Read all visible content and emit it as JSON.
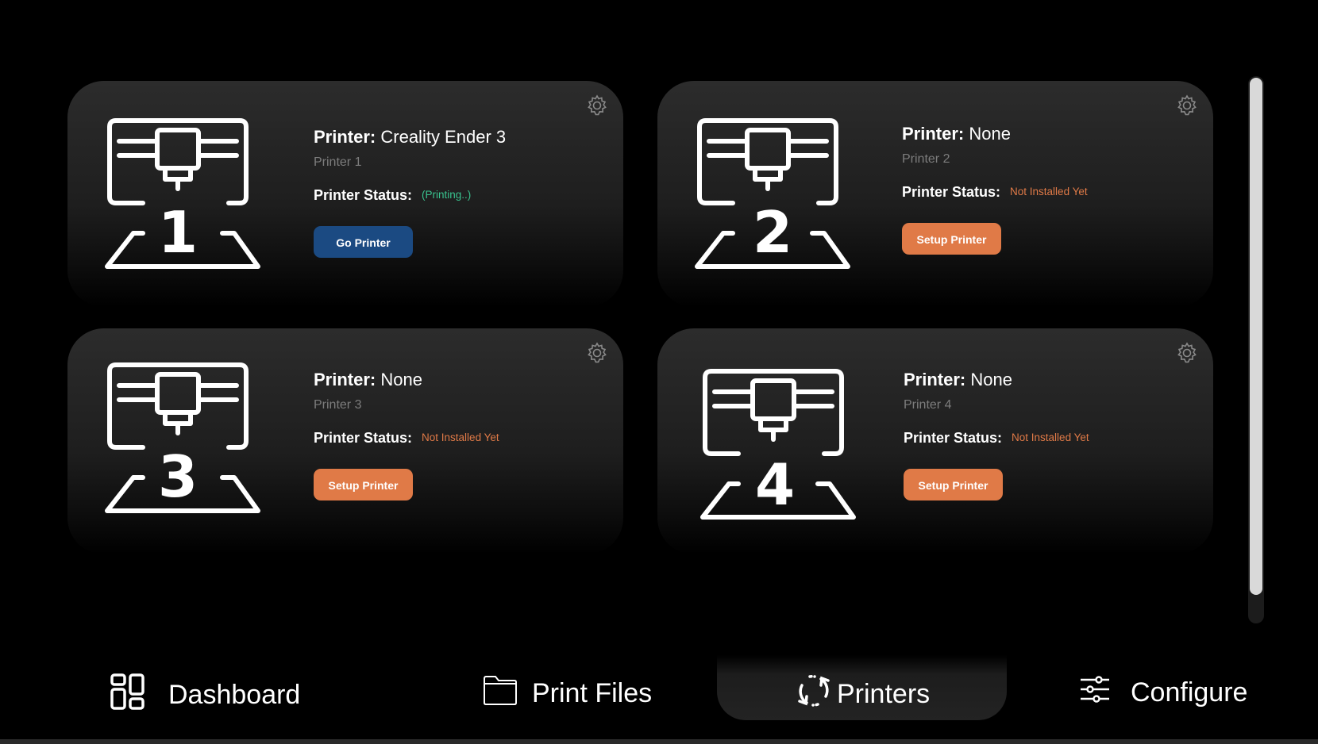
{
  "printers": [
    {
      "label": "Printer:",
      "name": "Creality Ender 3",
      "subtitle": "Printer 1",
      "status_label": "Printer Status:",
      "status": "(Printing..)",
      "number": "1",
      "button": "Go Printer",
      "status_color": "#39c38f",
      "button_color": "#1b4a82"
    },
    {
      "label": "Printer:",
      "name": "None",
      "subtitle": "Printer 2",
      "status_label": "Printer Status:",
      "status": "Not Installed Yet",
      "number": "2",
      "button": "Setup Printer",
      "status_color": "#e07a47",
      "button_color": "#e07a47"
    },
    {
      "label": "Printer:",
      "name": "None",
      "subtitle": "Printer 3",
      "status_label": "Printer Status:",
      "status": "Not Installed Yet",
      "number": "3",
      "button": "Setup Printer",
      "status_color": "#e07a47",
      "button_color": "#e07a47"
    },
    {
      "label": "Printer:",
      "name": "None",
      "subtitle": "Printer 4",
      "status_label": "Printer Status:",
      "status": "Not Installed Yet",
      "number": "4",
      "button": "Setup Printer",
      "status_color": "#e07a47",
      "button_color": "#e07a47"
    }
  ],
  "nav": {
    "items": [
      {
        "label": "Dashboard",
        "icon": "dashboard-grid-icon"
      },
      {
        "label": "Print Files",
        "icon": "folder-icon"
      },
      {
        "label": "Printers",
        "icon": "refresh-icon",
        "active": true
      },
      {
        "label": "Configure",
        "icon": "sliders-icon"
      }
    ]
  },
  "icons": {
    "settings": "gear-icon",
    "printer": "3d-printer-icon"
  }
}
